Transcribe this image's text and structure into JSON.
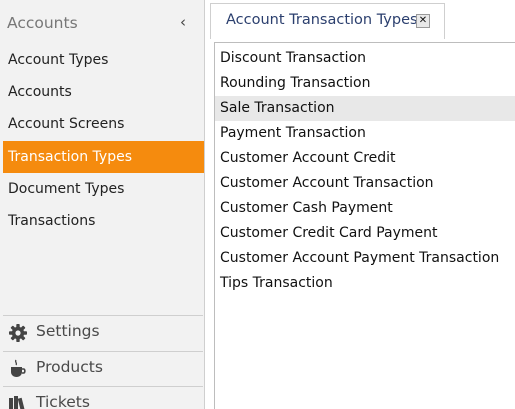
{
  "sidebar": {
    "title": "Accounts",
    "collapse_glyph": "‹",
    "items": [
      {
        "label": "Account Types",
        "active": false
      },
      {
        "label": "Accounts",
        "active": false
      },
      {
        "label": "Account Screens",
        "active": false
      },
      {
        "label": "Transaction Types",
        "active": true
      },
      {
        "label": "Document Types",
        "active": false
      },
      {
        "label": "Transactions",
        "active": false
      }
    ],
    "sections": [
      {
        "label": "Settings",
        "icon": "gear-icon"
      },
      {
        "label": "Products",
        "icon": "coffee-cup-icon"
      },
      {
        "label": "Tickets",
        "icon": "books-icon"
      }
    ]
  },
  "tab": {
    "label": "Account Transaction Types",
    "close_glyph": "✕"
  },
  "list": {
    "items": [
      "Discount Transaction",
      "Rounding Transaction",
      "Sale Transaction",
      "Payment Transaction",
      "Customer Account Credit",
      "Customer Account Transaction",
      "Customer Cash Payment",
      "Customer Credit Card Payment",
      "Customer Account Payment Transaction",
      "Tips Transaction"
    ],
    "highlighted_index": 2
  },
  "colors": {
    "accent": "#f58b0e",
    "tab_text": "#2b3f6e",
    "sidebar_bg": "#f2f2f2",
    "highlight_bg": "#e8e8e8"
  }
}
